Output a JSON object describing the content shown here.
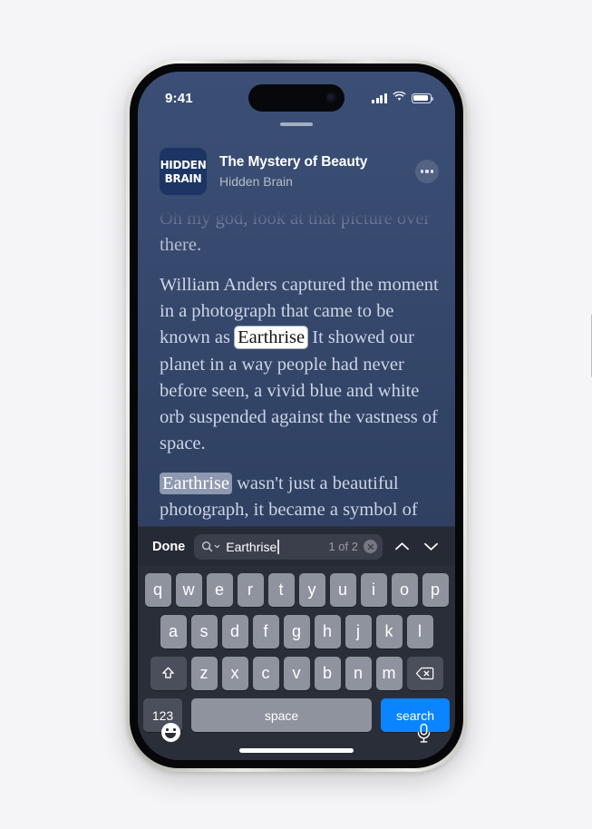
{
  "status_bar": {
    "time": "9:41",
    "cellular_icon": "cellular-bars-icon",
    "wifi_icon": "wifi-icon",
    "battery_icon": "battery-icon"
  },
  "sheet": {
    "grabber": "drag-handle"
  },
  "episode": {
    "artwork_line1": "HIDDEN",
    "artwork_line2": "BRAIN",
    "title": "The Mystery of Beauty",
    "show": "Hidden Brain",
    "more_button": "more-options"
  },
  "transcript": {
    "paragraphs": [
      {
        "id": "p1",
        "faded": true,
        "text": "Oh my god, look at that picture over there."
      },
      {
        "id": "p2",
        "faded": false,
        "before": "William Anders captured the moment in a photograph that came to be known as ",
        "highlight": "Earthrise",
        "highlight_state": "active",
        "after": " It showed our planet in a way people had never before seen, a vivid blue and white orb suspended against the vastness of space."
      },
      {
        "id": "p3",
        "faded": false,
        "before": "",
        "highlight": "Earthrise",
        "highlight_state": "match",
        "after": " wasn't just a beautiful photograph, it became a symbol of the environmental movement and had a profound impact on"
      }
    ]
  },
  "find_bar": {
    "done_label": "Done",
    "search_icon": "magnifier-icon",
    "scope_chevron_icon": "chevron-down-icon",
    "query_value": "Earthrise",
    "query_placeholder": "Search",
    "result_count": "1 of 2",
    "clear_icon": "clear-circle-icon",
    "previous_icon": "chevron-up-icon",
    "next_icon": "chevron-down-icon"
  },
  "keyboard": {
    "row1": [
      "q",
      "w",
      "e",
      "r",
      "t",
      "y",
      "u",
      "i",
      "o",
      "p"
    ],
    "row2": [
      "a",
      "s",
      "d",
      "f",
      "g",
      "h",
      "j",
      "k",
      "l"
    ],
    "row3": [
      "z",
      "x",
      "c",
      "v",
      "b",
      "n",
      "m"
    ],
    "shift_icon": "shift-icon",
    "backspace_icon": "backspace-icon",
    "numbers_label": "123",
    "space_label": "space",
    "return_label": "search",
    "emoji_icon": "emoji-smiley-icon",
    "dictation_icon": "microphone-icon"
  },
  "device": {
    "home_indicator": "home-indicator",
    "action_button": "action-button",
    "volume_up_button": "volume-up-button",
    "volume_down_button": "volume-down-button",
    "power_button": "power-button"
  },
  "colors": {
    "accent": "#0a84ff",
    "screen_bg_top": "#3b4f76",
    "screen_bg_bottom": "#2b3b59",
    "keyboard_bg": "#2a2e39",
    "key_bg": "#8e939e",
    "findbar_bg": "#262a35",
    "artwork_bg": "#1d3564"
  }
}
